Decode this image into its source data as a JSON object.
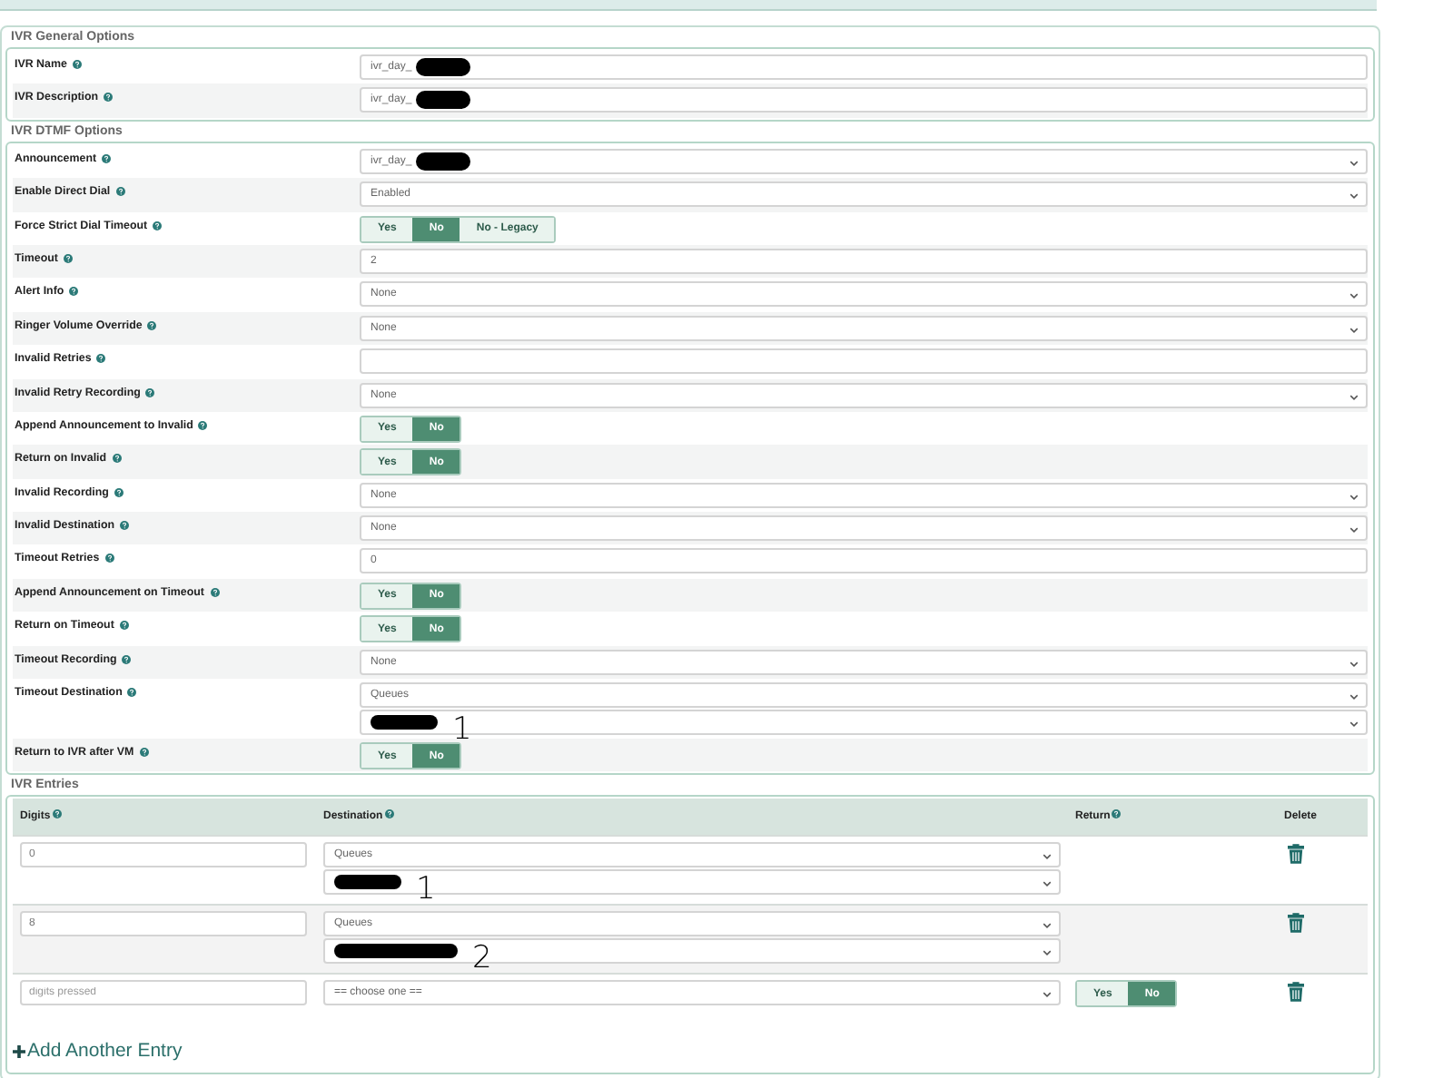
{
  "sections": [
    {
      "title": "IVR General Options",
      "rows": [
        {
          "kind": "input",
          "label": "IVR Name",
          "value": "ivr_day_",
          "redacted": true
        },
        {
          "kind": "input",
          "label": "IVR Description",
          "value": "ivr_day_",
          "redacted": true
        }
      ]
    },
    {
      "title": "IVR DTMF Options",
      "rows": [
        {
          "kind": "select",
          "label": "Announcement",
          "value": "ivr_day_",
          "redacted": true
        },
        {
          "kind": "select",
          "label": "Enable Direct Dial",
          "value": "Enabled"
        },
        {
          "kind": "toggle",
          "label": "Force Strict Dial Timeout",
          "options": [
            {
              "label": "Yes",
              "selected": false
            },
            {
              "label": "No",
              "selected": true
            },
            {
              "label": "No - Legacy",
              "selected": false
            }
          ]
        },
        {
          "kind": "input",
          "label": "Timeout",
          "value": "2"
        },
        {
          "kind": "select",
          "label": "Alert Info",
          "value": "None"
        },
        {
          "kind": "select",
          "label": "Ringer Volume Override",
          "value": "None"
        },
        {
          "kind": "input",
          "label": "Invalid Retries"
        },
        {
          "kind": "select",
          "label": "Invalid Retry Recording",
          "value": "None"
        },
        {
          "kind": "toggle",
          "label": "Append Announcement to Invalid",
          "options": [
            {
              "label": "Yes",
              "selected": false
            },
            {
              "label": "No",
              "selected": true
            }
          ]
        },
        {
          "kind": "toggle",
          "label": "Return on Invalid",
          "options": [
            {
              "label": "Yes",
              "selected": false
            },
            {
              "label": "No",
              "selected": true
            }
          ]
        },
        {
          "kind": "select",
          "label": "Invalid Recording",
          "value": "None"
        },
        {
          "kind": "select",
          "label": "Invalid Destination",
          "value": "None"
        },
        {
          "kind": "input",
          "label": "Timeout Retries",
          "value": "0"
        },
        {
          "kind": "toggle",
          "label": "Append Announcement on Timeout",
          "options": [
            {
              "label": "Yes",
              "selected": false
            },
            {
              "label": "No",
              "selected": true
            }
          ]
        },
        {
          "kind": "toggle",
          "label": "Return on Timeout",
          "options": [
            {
              "label": "Yes",
              "selected": false
            },
            {
              "label": "No",
              "selected": true
            }
          ]
        },
        {
          "kind": "select",
          "label": "Timeout Recording",
          "value": "None"
        },
        {
          "kind": "destination",
          "label": "Timeout Destination",
          "value": "Queues",
          "target": {
            "redacted": true,
            "annotation": "1"
          }
        },
        {
          "kind": "toggle",
          "label": "Return to IVR after VM",
          "options": [
            {
              "label": "Yes",
              "selected": false
            },
            {
              "label": "No",
              "selected": true
            }
          ]
        }
      ]
    }
  ],
  "entries": {
    "title": "IVR Entries",
    "columns": [
      "Digits",
      "Destination",
      "Return",
      "Delete"
    ],
    "rows": [
      {
        "digits": "0",
        "destination": "Queues",
        "target": {
          "redacted": true,
          "annotation": "1"
        }
      },
      {
        "digits": "8",
        "destination": "Queues",
        "target": {
          "redacted": true,
          "annotation": "2"
        }
      },
      {
        "digits_placeholder": "digits pressed",
        "destination": "== choose one ==",
        "return": [
          {
            "label": "Yes",
            "selected": false
          },
          {
            "label": "No",
            "selected": true
          }
        ]
      }
    ],
    "add_link": "Add Another Entry"
  }
}
